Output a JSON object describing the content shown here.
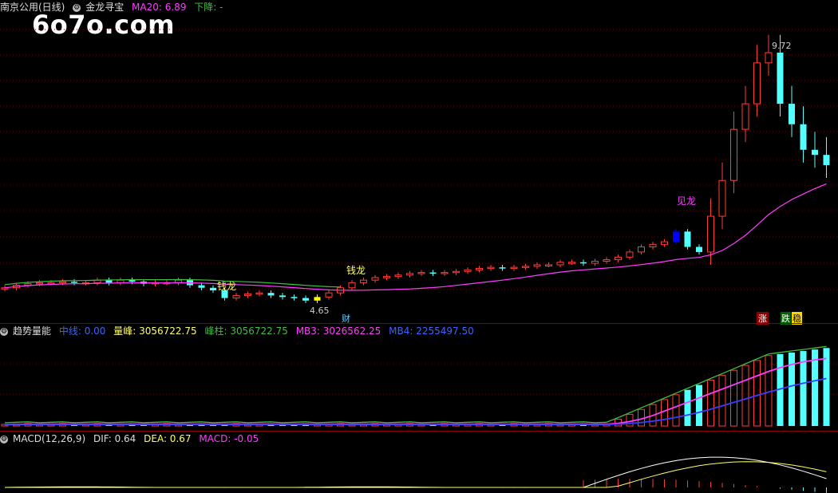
{
  "main_panel": {
    "stock_name": "南京公用(日线)",
    "indicator_name": "金龙寻宝",
    "ma20_label": "MA20: 6.89",
    "trend_label": "下降: -",
    "watermark": "6o7o.com",
    "high_label": "9.72",
    "low_label": "4.65",
    "annotations": [
      "钱龙",
      "钱龙",
      "见龙"
    ],
    "bottom_marker": "财",
    "right_markers": [
      "涨",
      "跌",
      "稳"
    ],
    "colors": {
      "up": "#ff3c3c",
      "down": "#54ffff",
      "ma": "#ff3cff",
      "line2": "#3cbf3c"
    }
  },
  "volume_panel": {
    "title": "趋势量能",
    "zhongxian": "中线: 0.00",
    "liangfeng": "量峰: 3056722.75",
    "fengzhu": "峰柱: 3056722.75",
    "mb3": "MB3: 3026562.25",
    "mb4": "MB4: 2255497.50"
  },
  "macd_panel": {
    "title": "MACD(12,26,9)",
    "dif": "DIF: 0.64",
    "dea": "DEA: 0.67",
    "macd": "MACD: -0.05"
  },
  "chart_data": {
    "type": "candlestick",
    "title": "南京公用(日线)",
    "series": [
      {
        "name": "MA20",
        "values": [
          6.89
        ]
      }
    ],
    "high": 9.72,
    "low": 4.65,
    "closes_approx": [
      4.9,
      4.95,
      4.98,
      5.0,
      5.0,
      5.02,
      5.0,
      5.0,
      5.05,
      5.0,
      5.05,
      5.02,
      4.98,
      5.0,
      5.0,
      5.05,
      4.95,
      4.9,
      4.85,
      4.7,
      4.75,
      4.78,
      4.8,
      4.75,
      4.72,
      4.7,
      4.65,
      4.72,
      4.8,
      4.9,
      5.0,
      5.05,
      5.1,
      5.12,
      5.15,
      5.18,
      5.2,
      5.18,
      5.2,
      5.22,
      5.25,
      5.28,
      5.3,
      5.28,
      5.3,
      5.32,
      5.35,
      5.35,
      5.4,
      5.4,
      5.38,
      5.42,
      5.45,
      5.5,
      5.6,
      5.7,
      5.75,
      5.8,
      6.0,
      5.7,
      5.6,
      6.3,
      7.0,
      8.0,
      8.5,
      9.3,
      9.5,
      8.5,
      8.1,
      7.6,
      7.5,
      7.3
    ]
  }
}
